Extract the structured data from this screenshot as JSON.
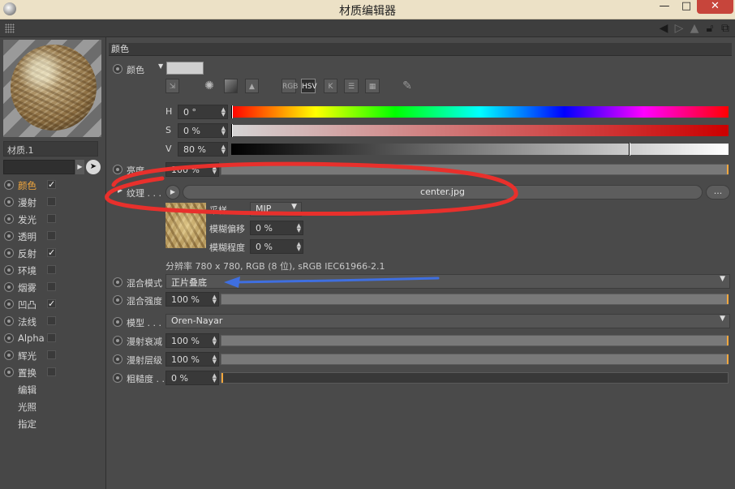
{
  "window": {
    "title": "材质编辑器",
    "minimize": "—",
    "maximize": "□",
    "close": "✕"
  },
  "toolbar": {
    "icons": [
      "back-arrow-icon",
      "forward-arrow-icon",
      "up-arrow-icon",
      "lock-icon",
      "new-window-icon"
    ]
  },
  "material": {
    "name": "材质.1"
  },
  "channels": [
    {
      "label": "颜色",
      "checked": true,
      "active": true
    },
    {
      "label": "漫射",
      "checked": false
    },
    {
      "label": "发光",
      "checked": false
    },
    {
      "label": "透明",
      "checked": false
    },
    {
      "label": "反射",
      "checked": true
    },
    {
      "label": "环境",
      "checked": false
    },
    {
      "label": "烟雾",
      "checked": false
    },
    {
      "label": "凹凸",
      "checked": true
    },
    {
      "label": "法线",
      "checked": false
    },
    {
      "label": "Alpha",
      "checked": false
    },
    {
      "label": "辉光",
      "checked": false
    },
    {
      "label": "置换",
      "checked": false
    }
  ],
  "extra_items": [
    "编辑",
    "光照",
    "指定"
  ],
  "check_mark": "✓",
  "color_section": {
    "header": "颜色",
    "color_label": "颜色",
    "swatch_color": "#cfcfcf",
    "mode_buttons": [
      "RGB",
      "HSV",
      "K"
    ],
    "selected_mode": "HSV",
    "h_label": "H",
    "h_value": "0 °",
    "s_label": "S",
    "s_value": "0 %",
    "v_label": "V",
    "v_value": "80 %",
    "v_fraction": 0.8,
    "brightness_label": "亮度",
    "brightness_value": "100 %"
  },
  "texture": {
    "label": "纹理 . . .",
    "filename": "center.jpg",
    "more_button": "...",
    "sampling_label": "采样",
    "sampling_value": "MIP",
    "blur_offset_label": "模糊偏移",
    "blur_offset_value": "0 %",
    "blur_scale_label": "模糊程度",
    "blur_scale_value": "0 %",
    "resolution_info": "分辨率 780 x 780, RGB (8 位), sRGB IEC61966-2.1"
  },
  "blend": {
    "mode_label": "混合模式",
    "mode_value": "正片叠底",
    "strength_label": "混合强度",
    "strength_value": "100 %"
  },
  "model": {
    "model_label": "模型 . . .",
    "model_value": "Oren-Nayar",
    "falloff_label": "漫射衰减",
    "falloff_value": "100 %",
    "level_label": "漫射层级",
    "level_value": "100 %",
    "roughness_label": "粗糙度 . .",
    "roughness_value": "0 %"
  },
  "annotation_colors": {
    "circle": "#e8302c",
    "arrow": "#3f6fe0"
  }
}
